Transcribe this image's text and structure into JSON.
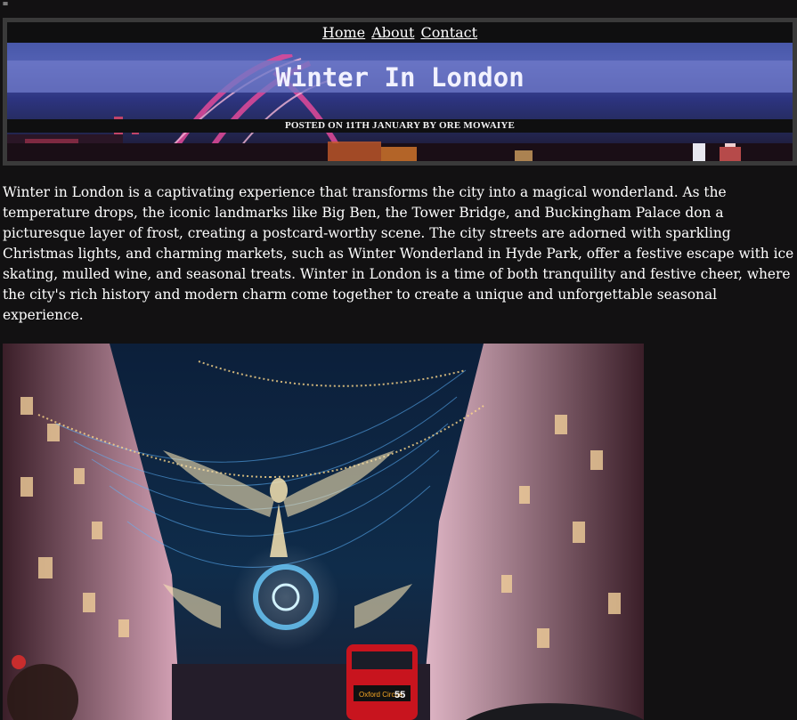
{
  "marker": "=",
  "nav": {
    "home": "Home",
    "about": "About",
    "contact": "Contact"
  },
  "header": {
    "title": "Winter In London",
    "posted": "POSTED ON 11TH JANUARY BY ORE MOWAIYE"
  },
  "article": {
    "intro": "Winter in London is a captivating experience that transforms the city into a magical wonderland. As the temperature drops, the iconic landmarks like Big Ben, the Tower Bridge, and Buckingham Palace don a picturesque layer of frost, creating a postcard-worthy scene. The city streets are adorned with sparkling Christmas lights, and charming markets, such as Winter Wonderland in Hyde Park, offer a festive escape with ice skating, mulled wine, and seasonal treats. Winter in London is a time of both tranquility and festive cheer, where the city's rich history and modern charm come together to create a unique and unforgettable seasonal experience."
  },
  "photo": {
    "bus_sign": "Oxford Circus",
    "bus_number": "55"
  },
  "colors": {
    "page_background": "#121112",
    "header_frame": "#3a3a3a",
    "title_band": "#6e78c8",
    "text": "#ffffff"
  }
}
